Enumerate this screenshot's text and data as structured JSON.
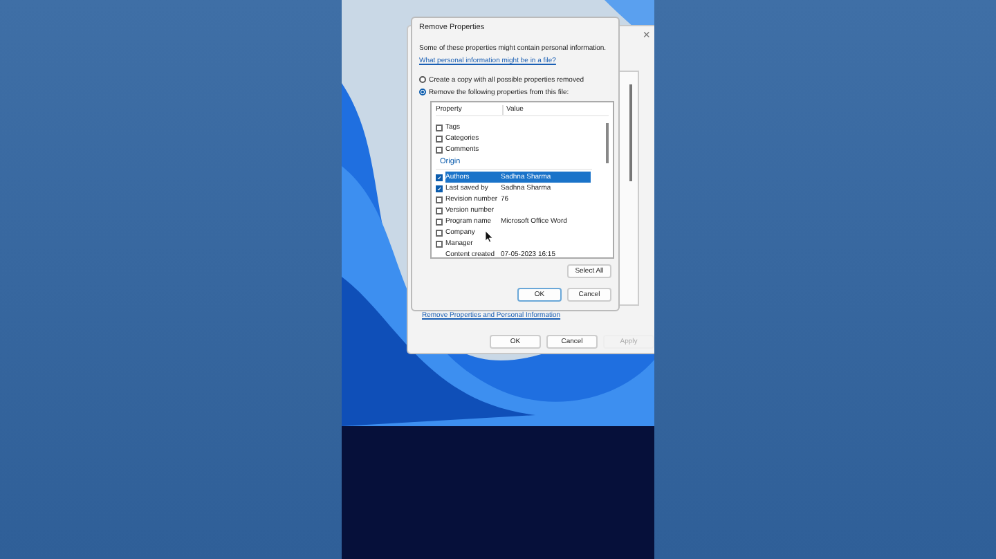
{
  "dialog": {
    "title": "Remove Properties",
    "intro": "Some of these properties might contain personal information.",
    "link": "What personal information might be in a file?",
    "options": [
      {
        "label": "Create a copy with all possible properties removed",
        "selected": false
      },
      {
        "label": "Remove the following properties from this file:",
        "selected": true
      }
    ],
    "list": {
      "columns": [
        "Property",
        "Value"
      ],
      "rows": [
        {
          "kind": "property",
          "name": "Tags",
          "checked": false,
          "selected": false
        },
        {
          "kind": "property",
          "name": "Categories",
          "checked": false,
          "selected": false
        },
        {
          "kind": "property",
          "name": "Comments",
          "checked": false,
          "selected": false
        },
        {
          "kind": "group",
          "name": "Origin"
        },
        {
          "kind": "property",
          "name": "Authors",
          "value": "Sadhna Sharma",
          "checked": true,
          "selected": true
        },
        {
          "kind": "property",
          "name": "Last saved by",
          "value": "Sadhna Sharma",
          "checked": true,
          "selected": false
        },
        {
          "kind": "property",
          "name": "Revision number",
          "value": "76",
          "checked": false,
          "selected": false
        },
        {
          "kind": "property",
          "name": "Version number",
          "checked": false,
          "selected": false
        },
        {
          "kind": "property",
          "name": "Program name",
          "value": "Microsoft Office Word",
          "checked": false,
          "selected": false
        },
        {
          "kind": "property",
          "name": "Company",
          "checked": false,
          "selected": false
        },
        {
          "kind": "property",
          "name": "Manager",
          "checked": false,
          "selected": false
        },
        {
          "kind": "readonly",
          "name": "Content created",
          "value": "07-05-2023 16:15"
        }
      ]
    },
    "select_all": "Select All",
    "buttons": [
      {
        "label": "OK",
        "default": true
      },
      {
        "label": "Cancel",
        "default": false
      }
    ]
  },
  "back_window": {
    "close": "×",
    "link": "Remove Properties and Personal Information",
    "buttons": [
      {
        "label": "OK",
        "disabled": false
      },
      {
        "label": "Cancel",
        "disabled": false
      },
      {
        "label": "Apply",
        "disabled": true
      }
    ]
  }
}
